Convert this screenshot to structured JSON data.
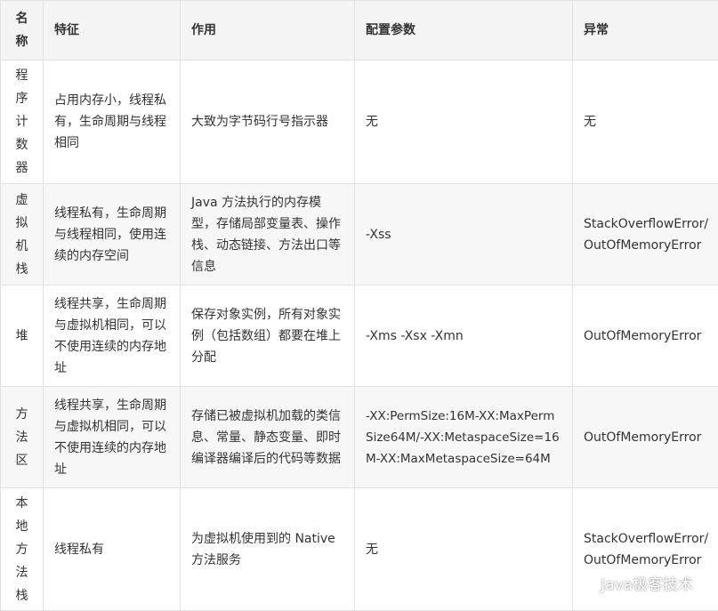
{
  "table": {
    "headers": [
      "名称",
      "特征",
      "作用",
      "配置参数",
      "异常"
    ],
    "rows": [
      {
        "name": "程序计数器",
        "feature": "占用内存小，线程私有，生命周期与线程相同",
        "role": "大致为字节码行号指示器",
        "params": "无",
        "exception": "无"
      },
      {
        "name": "虚拟机栈",
        "feature": "线程私有，生命周期与线程相同，使用连续的内存空间",
        "role": "Java 方法执行的内存模型，存储局部变量表、操作栈、动态链接、方法出口等信息",
        "params": "-Xss",
        "exception": "StackOverflowError/ OutOfMemoryError"
      },
      {
        "name": "堆",
        "feature": "线程共享，生命周期与虚拟机相同，可以不使用连续的内存地址",
        "role": "保存对象实例，所有对象实例（包括数组）都要在堆上分配",
        "params": "-Xms -Xsx -Xmn",
        "exception": "OutOfMemoryError"
      },
      {
        "name": "方法区",
        "feature": "线程共享，生命周期与虚拟机相同，可以不使用连续的内存地址",
        "role": "存储已被虚拟机加载的类信息、常量、静态变量、即时编译器编译后的代码等数据",
        "params": "-XX:PermSize:16M-XX:MaxPermSize64M/-XX:MetaspaceSize=16M-XX:MaxMetaspaceSize=64M",
        "exception": "OutOfMemoryError"
      },
      {
        "name": "本地方法栈",
        "feature": "线程私有",
        "role": "为虚拟机使用到的 Native 方法服务",
        "params": "无",
        "exception": "StackOverflowError/ OutOfMemoryError"
      }
    ]
  },
  "watermark": {
    "text": "Java极客技术",
    "icon": "wechat-icon"
  }
}
